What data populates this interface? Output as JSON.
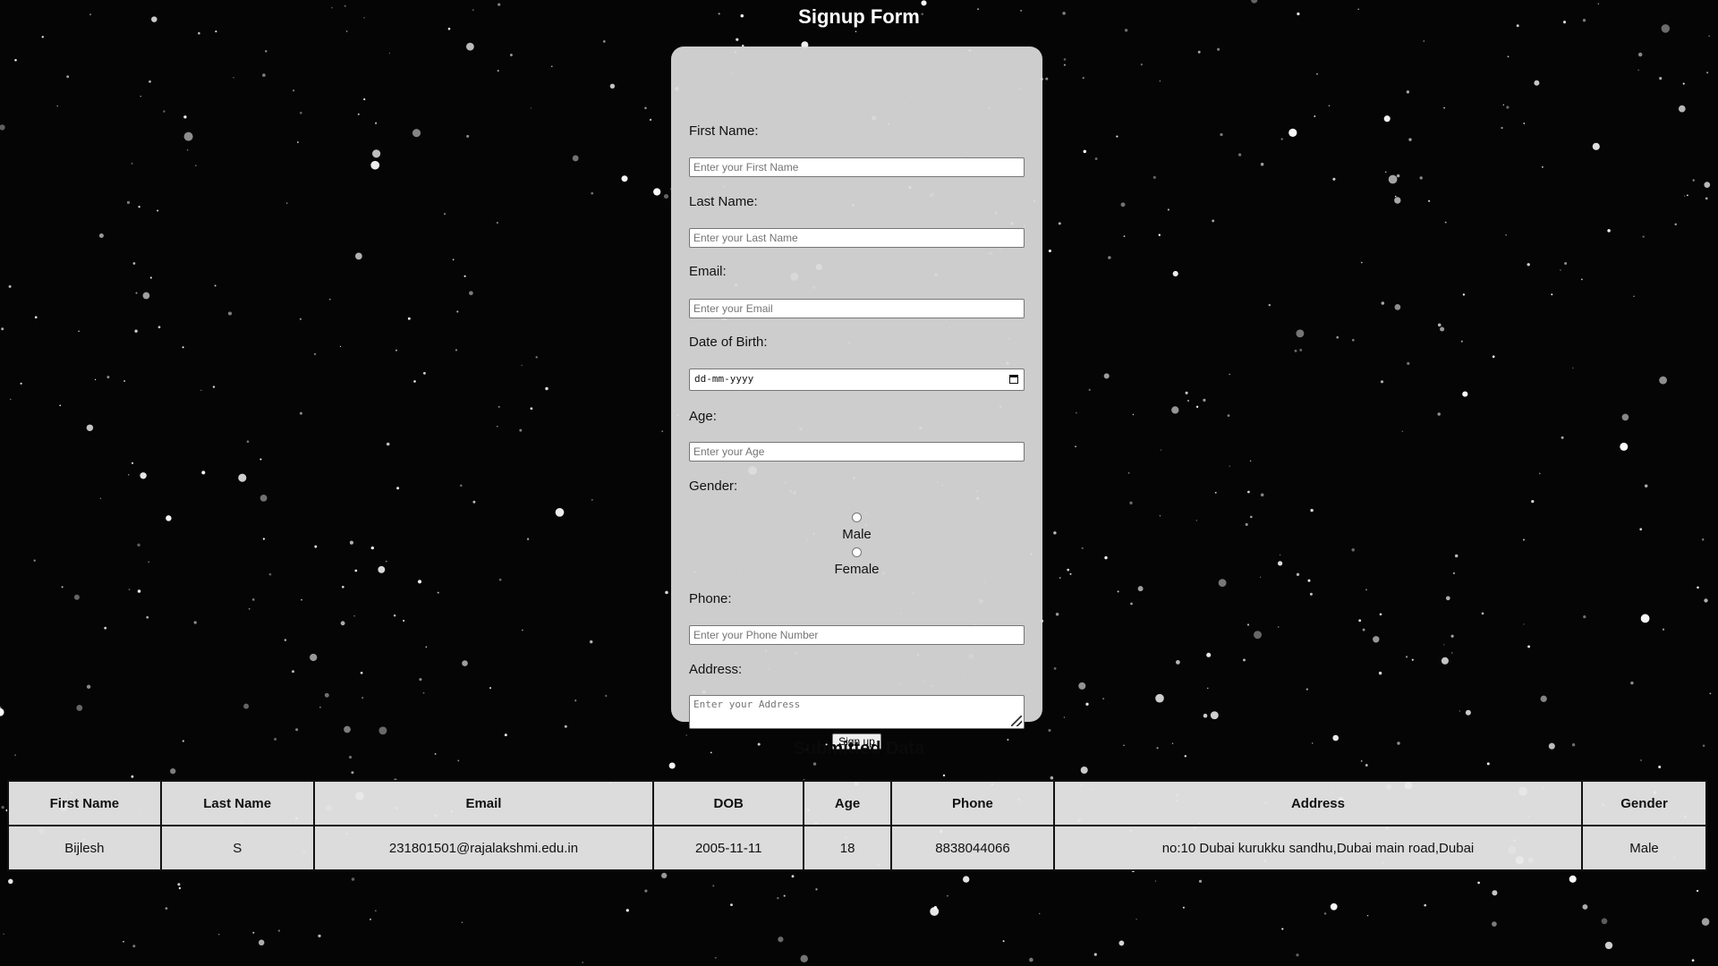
{
  "page": {
    "title": "Signup Form"
  },
  "form": {
    "first_name": {
      "label": "First Name:",
      "placeholder": "Enter your First Name"
    },
    "last_name": {
      "label": "Last Name:",
      "placeholder": "Enter your Last Name"
    },
    "email": {
      "label": "Email:",
      "placeholder": "Enter your Email"
    },
    "dob": {
      "label": "Date of Birth:",
      "placeholder": "dd-mm-yyyy"
    },
    "age": {
      "label": "Age:",
      "placeholder": "Enter your Age"
    },
    "gender": {
      "label": "Gender:",
      "options": [
        "Male",
        "Female"
      ]
    },
    "phone": {
      "label": "Phone:",
      "placeholder": "Enter your Phone Number"
    },
    "address": {
      "label": "Address:",
      "placeholder": "Enter your Address"
    },
    "submit_label": "Sign up"
  },
  "submitted": {
    "heading": "Submitted Data",
    "columns": [
      "First Name",
      "Last Name",
      "Email",
      "DOB",
      "Age",
      "Phone",
      "Address",
      "Gender"
    ],
    "rows": [
      [
        "Bijlesh",
        "S",
        "231801501@rajalakshmi.edu.in",
        "2005-11-11",
        "18",
        "8838044066",
        "no:10 Dubai kurukku sandhu,Dubai main road,Dubai",
        "Male"
      ]
    ]
  },
  "colors": {
    "background": "#050505",
    "card": "#dadada",
    "title_text": "#ffffff"
  }
}
